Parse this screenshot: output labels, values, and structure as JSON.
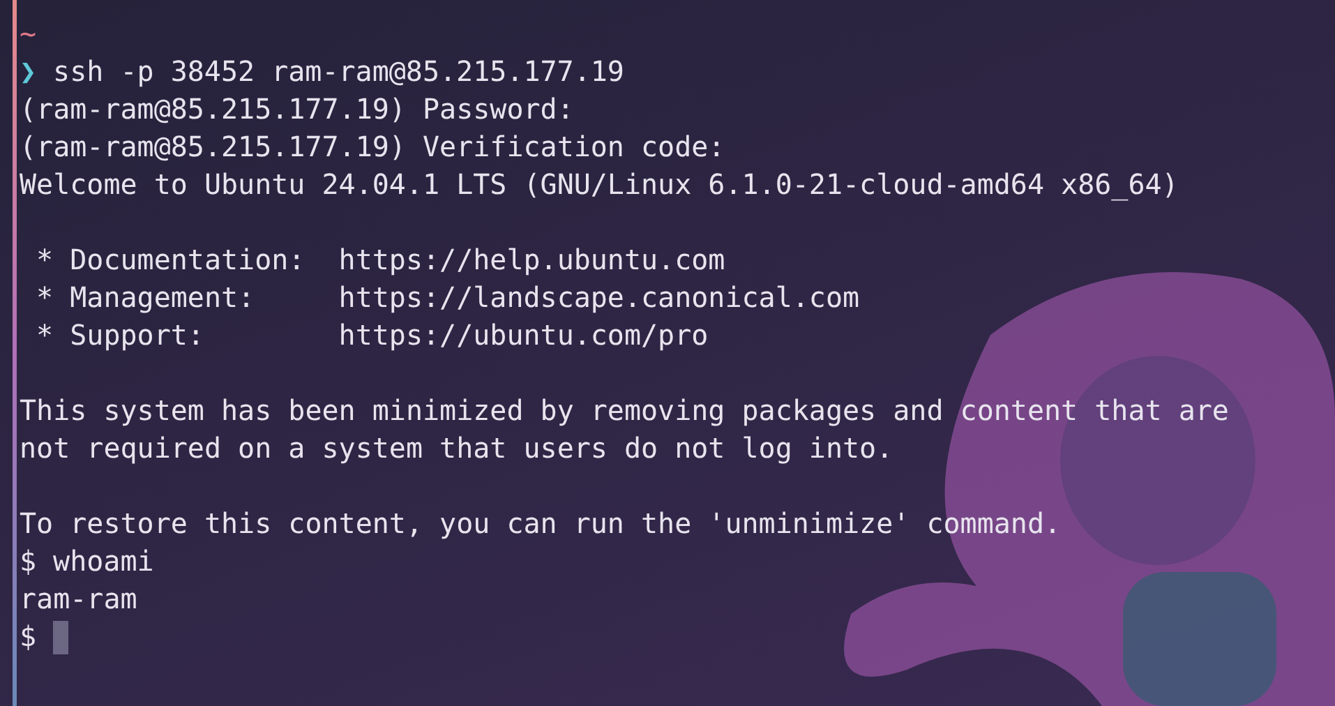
{
  "terminal": {
    "lines": [
      {
        "kind": "cwd",
        "text": "~"
      },
      {
        "kind": "prompt",
        "symbol": "❯",
        "command": "ssh -p 38452 ram-ram@85.215.177.19"
      },
      {
        "kind": "output",
        "text": "(ram-ram@85.215.177.19) Password:"
      },
      {
        "kind": "output",
        "text": "(ram-ram@85.215.177.19) Verification code:"
      },
      {
        "kind": "output",
        "text": "Welcome to Ubuntu 24.04.1 LTS (GNU/Linux 6.1.0-21-cloud-amd64 x86_64)"
      },
      {
        "kind": "blank"
      },
      {
        "kind": "output",
        "text": " * Documentation:  https://help.ubuntu.com"
      },
      {
        "kind": "output",
        "text": " * Management:     https://landscape.canonical.com"
      },
      {
        "kind": "output",
        "text": " * Support:        https://ubuntu.com/pro"
      },
      {
        "kind": "blank"
      },
      {
        "kind": "output",
        "text": "This system has been minimized by removing packages and content that are"
      },
      {
        "kind": "output",
        "text": "not required on a system that users do not log into."
      },
      {
        "kind": "blank"
      },
      {
        "kind": "output",
        "text": "To restore this content, you can run the 'unminimize' command."
      },
      {
        "kind": "shell",
        "symbol": "$",
        "command": "whoami",
        "cursor": false
      },
      {
        "kind": "output",
        "text": "ram-ram"
      },
      {
        "kind": "shell",
        "symbol": "$",
        "cursor": true
      }
    ]
  }
}
